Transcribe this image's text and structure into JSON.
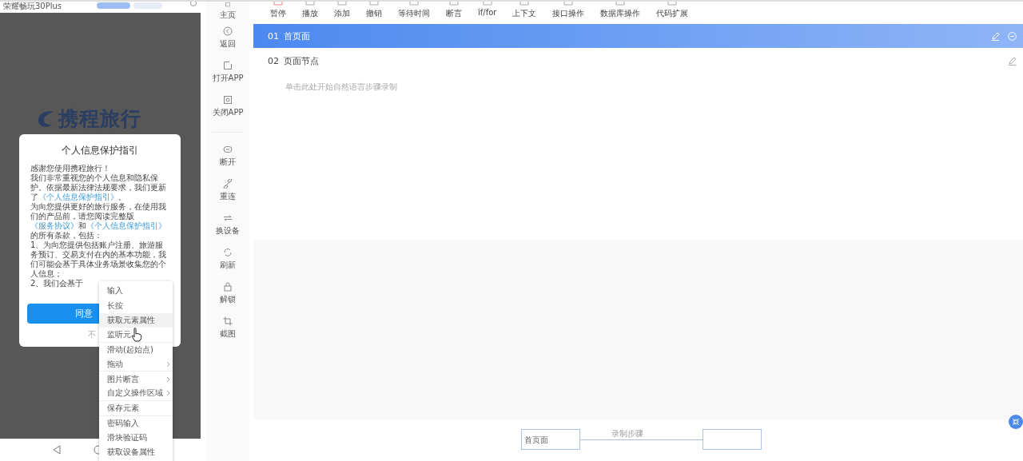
{
  "device": {
    "name": "荣耀畅玩30Plus"
  },
  "app_logo": {
    "text": "携程旅行"
  },
  "dialog": {
    "title": "个人信息保护指引",
    "paragraphs": [
      [
        {
          "text": "感谢您使用携程旅行！",
          "kind": "text"
        }
      ],
      [
        {
          "text": "我们非常重视您的个人信息和隐私保护。依据最新法律法规要求，我们更新了",
          "kind": "text"
        },
        {
          "text": "《个人信息保护指引》",
          "kind": "link"
        },
        {
          "text": "。",
          "kind": "text"
        }
      ],
      [
        {
          "text": "为向您提供更好的旅行服务，在使用我们的产品前，请您阅读完整版",
          "kind": "text"
        },
        {
          "text": "《服务协议》",
          "kind": "link"
        },
        {
          "text": "和",
          "kind": "text"
        },
        {
          "text": "《个人信息保护指引》",
          "kind": "link"
        },
        {
          "text": "的所有条款，包括：",
          "kind": "text"
        }
      ],
      [
        {
          "text": "1、为向您提供包括账户注册、旅游服务预订、交易支付在内的基本功能，我们可能会基于具体业务场景收集您的个人信息；",
          "kind": "text"
        }
      ],
      [
        {
          "text": "2、我们会基于",
          "kind": "text"
        }
      ]
    ],
    "agree_button": "同意",
    "decline_link": "不"
  },
  "context_menu": [
    {
      "label": "输入",
      "submenu": false,
      "hovered": false,
      "divider_after": false
    },
    {
      "label": "长按",
      "submenu": false,
      "hovered": false,
      "divider_after": false
    },
    {
      "label": "获取元素属性",
      "submenu": false,
      "hovered": true,
      "divider_after": false
    },
    {
      "label": "监听元",
      "submenu": false,
      "hovered": false,
      "divider_after": true
    },
    {
      "label": "滑动(起始点)",
      "submenu": false,
      "hovered": false,
      "divider_after": false
    },
    {
      "label": "拖动",
      "submenu": true,
      "hovered": false,
      "divider_after": true
    },
    {
      "label": "图片断言",
      "submenu": true,
      "hovered": false,
      "divider_after": false
    },
    {
      "label": "自定义操作区域",
      "submenu": true,
      "hovered": false,
      "divider_after": true
    },
    {
      "label": "保存元素",
      "submenu": false,
      "hovered": false,
      "divider_after": true
    },
    {
      "label": "密码输入",
      "submenu": false,
      "hovered": false,
      "divider_after": false
    },
    {
      "label": "滑块验证码",
      "submenu": false,
      "hovered": false,
      "divider_after": false
    },
    {
      "label": "获取设备属性",
      "submenu": false,
      "hovered": false,
      "divider_after": false
    }
  ],
  "sidebar": {
    "groups": [
      [
        {
          "label": "主页",
          "kind": "home"
        },
        {
          "label": "返回",
          "kind": "back"
        },
        {
          "label": "打开APP",
          "kind": "open"
        },
        {
          "label": "关闭APP",
          "kind": "close"
        }
      ],
      [
        {
          "label": "断开",
          "kind": "disconnect"
        },
        {
          "label": "重连",
          "kind": "link"
        },
        {
          "label": "换设备",
          "kind": "swap"
        },
        {
          "label": "刷新",
          "kind": "refresh"
        },
        {
          "label": "解锁",
          "kind": "lock"
        },
        {
          "label": "截图",
          "kind": "crop"
        }
      ]
    ]
  },
  "toolbar": [
    "暂停",
    "播放",
    "添加",
    "撤销",
    "等待时间",
    "断言",
    "if/for",
    "上下文",
    "接口操作",
    "数据库操作",
    "代码扩展"
  ],
  "steps": [
    {
      "number": "01",
      "title": "首页面",
      "selected": true
    },
    {
      "number": "02",
      "title": "页面节点",
      "selected": false
    }
  ],
  "step_placeholder": "单击此处开始自然语言步骤录制",
  "flow": {
    "source_node": "首页面",
    "edge_label": "录制步骤"
  }
}
